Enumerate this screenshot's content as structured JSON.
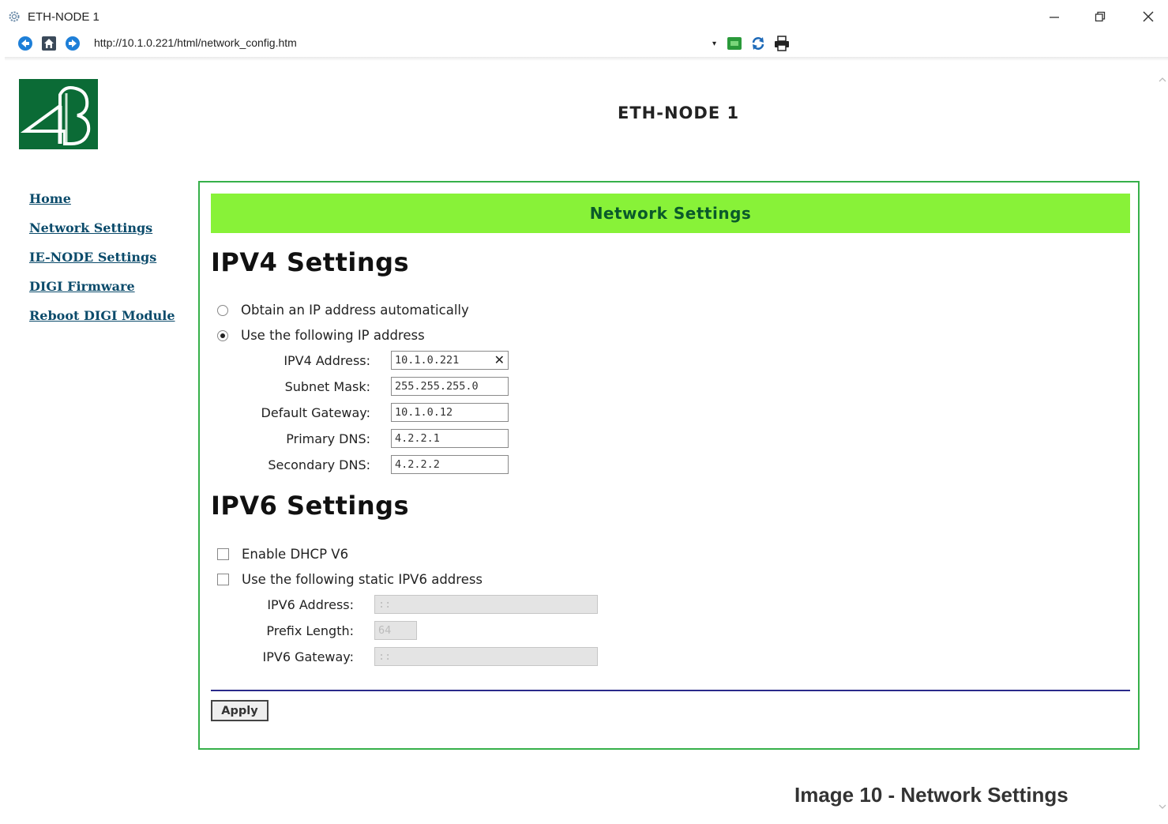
{
  "window": {
    "title": "ETH-NODE 1",
    "url": "http://10.1.0.221/html/network_config.htm"
  },
  "header": {
    "page_title": "ETH-NODE 1"
  },
  "sidebar": {
    "items": [
      {
        "label": "Home"
      },
      {
        "label": "Network Settings"
      },
      {
        "label": "IE-NODE Settings"
      },
      {
        "label": "DIGI Firmware"
      },
      {
        "label": "Reboot DIGI Module"
      }
    ]
  },
  "main": {
    "banner": "Network Settings",
    "ipv4": {
      "heading": "IPV4 Settings",
      "option_auto": "Obtain an IP address automatically",
      "option_manual": "Use the following IP address",
      "selected": "manual",
      "fields": [
        {
          "label": "IPV4 Address:",
          "value": "10.1.0.221"
        },
        {
          "label": "Subnet Mask:",
          "value": "255.255.255.0"
        },
        {
          "label": "Default Gateway:",
          "value": "10.1.0.12"
        },
        {
          "label": "Primary DNS:",
          "value": "4.2.2.1"
        },
        {
          "label": "Secondary DNS:",
          "value": "4.2.2.2"
        }
      ]
    },
    "ipv6": {
      "heading": "IPV6 Settings",
      "option_dhcp": "Enable DHCP V6",
      "option_static": "Use the following static IPV6 address",
      "dhcp_checked": false,
      "static_checked": false,
      "fields": [
        {
          "label": "IPV6 Address:",
          "value": "::"
        },
        {
          "label": "Prefix Length:",
          "value": "64"
        },
        {
          "label": "IPV6 Gateway:",
          "value": "::"
        }
      ]
    },
    "apply_label": "Apply"
  },
  "caption": "Image 10 - Network Settings",
  "colors": {
    "banner_bg": "#88f238",
    "panel_border": "#36b04a",
    "logo_bg": "#0b6b36",
    "link": "#0b4b6b"
  }
}
